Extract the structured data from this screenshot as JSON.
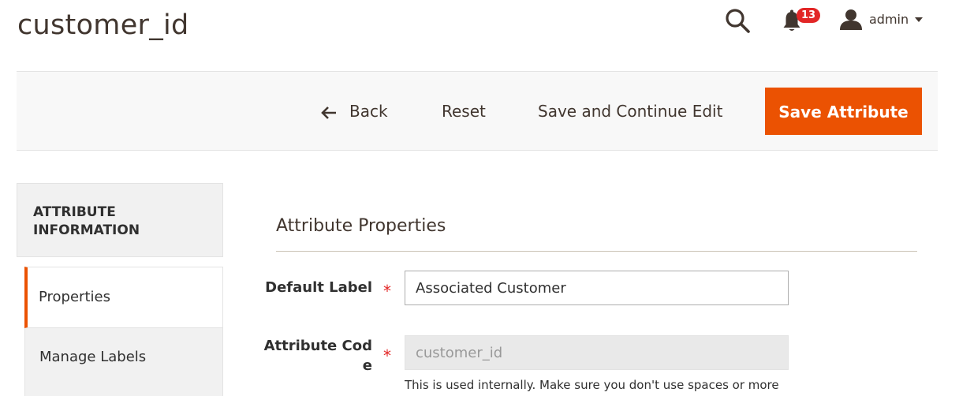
{
  "page": {
    "title": "customer_id"
  },
  "header": {
    "notification_count": "13",
    "user_name": "admin",
    "icons": [
      "search-icon",
      "bell-icon",
      "user-icon",
      "caret-down-icon"
    ]
  },
  "toolbar": {
    "back_label": "Back",
    "reset_label": "Reset",
    "save_continue_label": "Save and Continue Edit",
    "save_label": "Save Attribute"
  },
  "sidebar": {
    "title": "ATTRIBUTE INFORMATION",
    "items": [
      {
        "label": "Properties",
        "active": true
      },
      {
        "label": "Manage Labels",
        "active": false
      }
    ]
  },
  "form": {
    "section_title": "Attribute Properties",
    "default_label": {
      "label": "Default Label",
      "value": "Associated Customer",
      "required": true
    },
    "attribute_code": {
      "label": "Attribute Cod\ne",
      "value": "customer_id",
      "required": true,
      "disabled": true,
      "note": "This is used internally. Make sure you don't use spaces or more"
    }
  },
  "colors": {
    "accent": "#eb5202",
    "badge": "#e22626",
    "text": "#303030",
    "title": "#41362f",
    "toolbar_bg": "#f8f8f8"
  }
}
